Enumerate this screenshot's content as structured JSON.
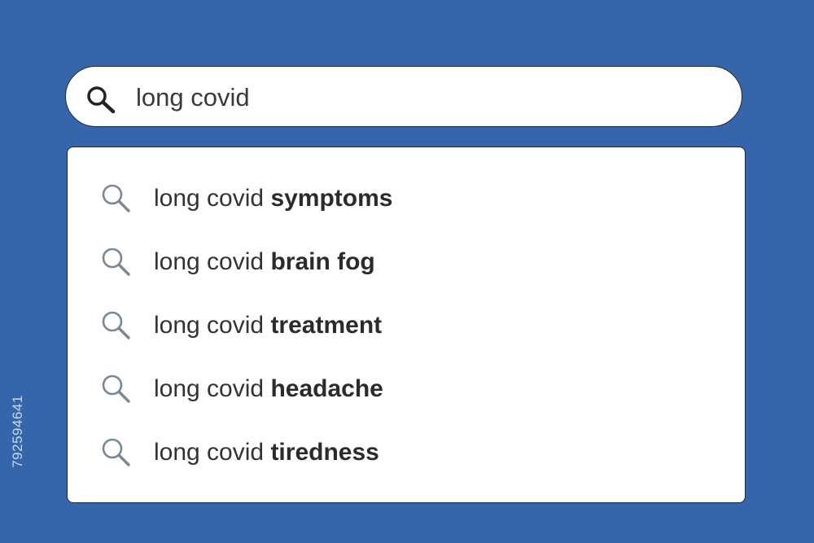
{
  "search": {
    "query": "long covid",
    "icon": "search-icon"
  },
  "suggestions": [
    {
      "prefix": "long covid",
      "suffix": "symptoms",
      "icon": "search-icon"
    },
    {
      "prefix": "long covid",
      "suffix": "brain fog",
      "icon": "search-icon"
    },
    {
      "prefix": "long covid",
      "suffix": "treatment",
      "icon": "search-icon"
    },
    {
      "prefix": "long covid",
      "suffix": "headache",
      "icon": "search-icon"
    },
    {
      "prefix": "long covid",
      "suffix": "tiredness",
      "icon": "search-icon"
    }
  ],
  "stock_id": "792594641",
  "colors": {
    "background": "#3566ab",
    "panel": "#ffffff",
    "suggestion_icon": "#7b8796",
    "main_icon": "#222222"
  }
}
